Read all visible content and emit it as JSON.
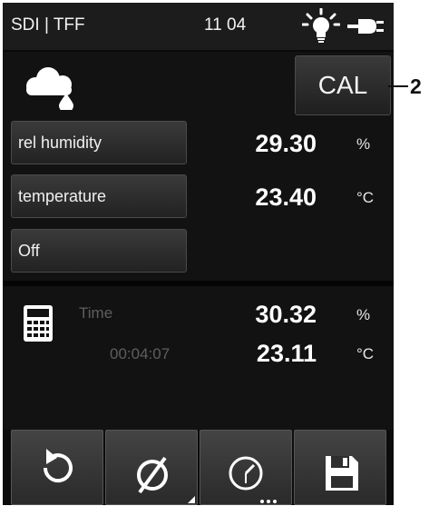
{
  "status_bar": {
    "app_label": "SDI | TFF",
    "time": "11 04",
    "icons": [
      "lightbulb-icon",
      "power-plug-icon"
    ]
  },
  "header": {
    "icon": "cloud-rain-icon",
    "cal_button_label": "CAL"
  },
  "callout": {
    "number": "2"
  },
  "channels": [
    {
      "label": "rel humidity",
      "value": "29.30",
      "unit": "%"
    },
    {
      "label": "temperature",
      "value": "23.40",
      "unit": "°C"
    },
    {
      "label": "Off"
    }
  ],
  "mean": {
    "icon": "calculator-icon",
    "label": "Time",
    "elapsed": "00:04:07",
    "values": [
      {
        "value": "30.32",
        "unit": "%"
      },
      {
        "value": "23.11",
        "unit": "°C"
      }
    ]
  },
  "toolbar": {
    "buttons": [
      "refresh-icon",
      "diameter-icon",
      "clock-icon",
      "save-icon"
    ]
  },
  "colors": {
    "screen_background": "#121212",
    "button_face": "#2e2e2e",
    "text": "#ffffff",
    "dim_text": "#5e5e5e"
  }
}
